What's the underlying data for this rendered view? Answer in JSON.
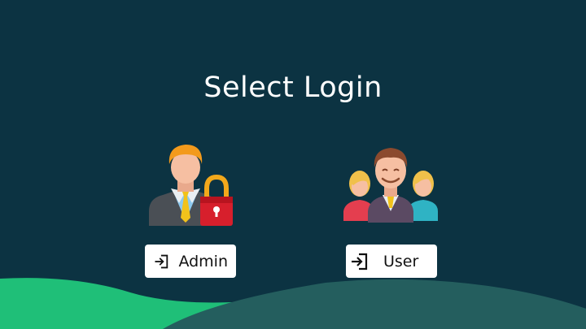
{
  "page": {
    "title": "Select Login"
  },
  "options": [
    {
      "id": "admin",
      "label": "Admin",
      "icon": "sign-in-icon",
      "illustration": "admin-lock-illustration"
    },
    {
      "id": "user",
      "label": "User",
      "icon": "sign-in-icon",
      "illustration": "user-group-illustration"
    }
  ],
  "colors": {
    "background": "#0c3342",
    "wave_green": "#1fbf78",
    "wave_teal": "#245e5e",
    "button_bg": "#ffffff"
  }
}
